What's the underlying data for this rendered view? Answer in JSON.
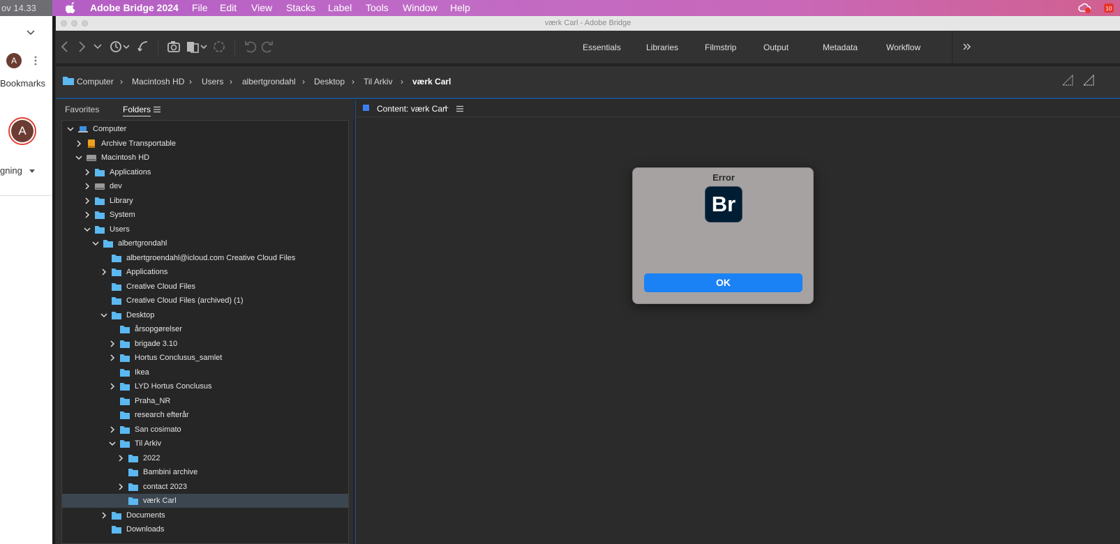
{
  "menubar": {
    "clock": "ov  14.33",
    "app_name": "Adobe Bridge 2024",
    "menus": [
      "File",
      "Edit",
      "View",
      "Stacks",
      "Label",
      "Tools",
      "Window",
      "Help"
    ],
    "notification_count": "10"
  },
  "browser_sidebar": {
    "avatar_letter": "A",
    "bookmarks_label": "Bookmarks",
    "profile_letter": "A",
    "sync_label": "gning"
  },
  "window": {
    "title": "værk Carl - Adobe Bridge"
  },
  "workspaces": [
    "Essentials",
    "Libraries",
    "Filmstrip",
    "Output",
    "Metadata",
    "Workflow"
  ],
  "breadcrumb": [
    "Computer",
    "Macintosh HD",
    "Users",
    "albertgrondahl",
    "Desktop",
    "Til Arkiv",
    "værk Carl"
  ],
  "left_panel": {
    "tabs": [
      "Favorites",
      "Folders"
    ],
    "tree": [
      {
        "label": "Computer",
        "depth": 0,
        "expander": "open",
        "icon": "computer"
      },
      {
        "label": "Archive Transportable",
        "depth": 1,
        "expander": "closed",
        "icon": "drive-orange"
      },
      {
        "label": "Macintosh HD",
        "depth": 1,
        "expander": "open",
        "icon": "disk"
      },
      {
        "label": "Applications",
        "depth": 2,
        "expander": "closed",
        "icon": "folder"
      },
      {
        "label": "dev",
        "depth": 2,
        "expander": "closed",
        "icon": "disk"
      },
      {
        "label": "Library",
        "depth": 2,
        "expander": "closed",
        "icon": "folder"
      },
      {
        "label": "System",
        "depth": 2,
        "expander": "closed",
        "icon": "folder"
      },
      {
        "label": "Users",
        "depth": 2,
        "expander": "open",
        "icon": "folder"
      },
      {
        "label": "albertgrondahl",
        "depth": 3,
        "expander": "open",
        "icon": "folder"
      },
      {
        "label": "albertgroendahl@icloud.com Creative Cloud Files",
        "depth": 4,
        "expander": "none",
        "icon": "folder"
      },
      {
        "label": "Applications",
        "depth": 4,
        "expander": "closed",
        "icon": "folder"
      },
      {
        "label": "Creative Cloud Files",
        "depth": 4,
        "expander": "none",
        "icon": "folder"
      },
      {
        "label": "Creative Cloud Files (archived) (1)",
        "depth": 4,
        "expander": "none",
        "icon": "folder"
      },
      {
        "label": "Desktop",
        "depth": 4,
        "expander": "open",
        "icon": "folder"
      },
      {
        "label": "årsopgørelser",
        "depth": 5,
        "expander": "none",
        "icon": "folder"
      },
      {
        "label": "brigade 3.10",
        "depth": 5,
        "expander": "closed",
        "icon": "folder"
      },
      {
        "label": "Hortus Conclusus_samlet",
        "depth": 5,
        "expander": "closed",
        "icon": "folder"
      },
      {
        "label": "Ikea",
        "depth": 5,
        "expander": "none",
        "icon": "folder"
      },
      {
        "label": "LYD Hortus Conclusus",
        "depth": 5,
        "expander": "closed",
        "icon": "folder"
      },
      {
        "label": "Praha_NR",
        "depth": 5,
        "expander": "none",
        "icon": "folder"
      },
      {
        "label": "research efterår",
        "depth": 5,
        "expander": "none",
        "icon": "folder"
      },
      {
        "label": "San cosimato",
        "depth": 5,
        "expander": "closed",
        "icon": "folder"
      },
      {
        "label": "Til Arkiv",
        "depth": 5,
        "expander": "open",
        "icon": "folder"
      },
      {
        "label": "2022",
        "depth": 6,
        "expander": "closed",
        "icon": "folder"
      },
      {
        "label": "Bambini archive",
        "depth": 6,
        "expander": "none",
        "icon": "folder"
      },
      {
        "label": "contact 2023",
        "depth": 6,
        "expander": "closed",
        "icon": "folder"
      },
      {
        "label": "værk Carl",
        "depth": 6,
        "expander": "none",
        "icon": "folder",
        "selected": true
      },
      {
        "label": "Documents",
        "depth": 4,
        "expander": "closed",
        "icon": "folder"
      },
      {
        "label": "Downloads",
        "depth": 4,
        "expander": "none",
        "icon": "folder"
      }
    ]
  },
  "content": {
    "tab_label": "Content: værk Carl"
  },
  "dialog": {
    "title": "Error",
    "app_icon_text": "Br",
    "ok_label": "OK"
  },
  "colors": {
    "accent": "#1a82f5",
    "folder": "#5cb8f0",
    "selection": "#3c4650"
  }
}
